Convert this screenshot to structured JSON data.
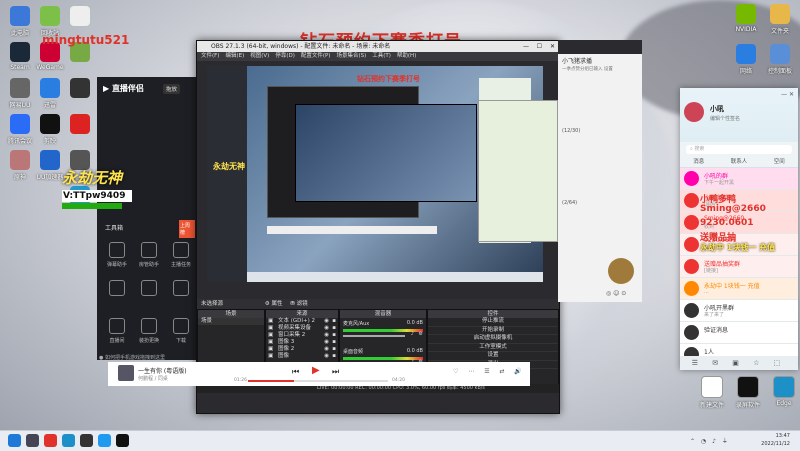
{
  "colors": {
    "obs_dark": "#2b2b2f",
    "accent_red": "#e0322a",
    "overlay_yellow": "#ffe44d",
    "qq_blue": "#1e9bf0"
  },
  "overlay": {
    "top_banner": "钻石预约下赛季打号",
    "username": "mingtutu521",
    "game_title": "永劫无神",
    "vt_handle": "V:TTpw9409",
    "qq_num_line1": "小鸭多鸭",
    "qq_num_line2": "Sming@2660",
    "promo_line1": "9230.0601",
    "promo_line2": "送赠品抽",
    "promo_line3": "永劫中 1块钱一 充值"
  },
  "live_panel": {
    "logo": "直播伴侣",
    "tab_status": "拖放",
    "tools_label": "工具箱",
    "rows": [
      {
        "items": [
          "弹幕助手",
          "房管助手",
          "主播任务"
        ]
      },
      {
        "items": [
          "",
          "",
          ""
        ]
      },
      {
        "items": [
          "直播间",
          "装扮更换",
          "下载"
        ]
      }
    ],
    "hint": "如何把手机游戏拖拽到这里",
    "side_tab": "上周榜"
  },
  "obs": {
    "title": "OBS 27.1.3 (64-bit, windows) - 配置文件: 未命名 - 场景: 未命名",
    "menu": [
      "文件(F)",
      "编辑(E)",
      "视图(V)",
      "停靠(D)",
      "配置文件(P)",
      "场景集合(S)",
      "工具(T)",
      "帮助(H)"
    ],
    "status_label": "未选择源",
    "props_btn": "属性",
    "filter_btn": "滤镜",
    "docks": {
      "scenes": "场景",
      "sources": "来源",
      "mixer": "混音器",
      "controls": "控件"
    },
    "scene_items": [
      "场景"
    ],
    "sources": [
      "文本 (GDI+) 2",
      "视频采集设备",
      "窗口采集 2",
      "图像 3",
      "图像 2",
      "图像"
    ],
    "mixer_tracks": [
      {
        "name": "麦克风/Aux",
        "level": "0.0 dB"
      },
      {
        "name": "桌面音频",
        "level": "0.0 dB"
      }
    ],
    "mixer_tabs": [
      "音频混音器",
      "转场"
    ],
    "controls": [
      "停止推流",
      "开始录制",
      "启动虚拟摄像机",
      "工作室模式",
      "设置",
      "退出"
    ],
    "status_bar": "LIVE: 00:00:00   REC: 00:00:00   CPU: 3.0%, 60.00 fps   码率: 4500 kb/s"
  },
  "music": {
    "song": "一生有你 (粤语版)",
    "artist": "何鹏程 / 同桌",
    "time_cur": "01:26",
    "time_total": "04:20",
    "progress": 0.33
  },
  "qq": {
    "name": "小吼",
    "status": "编辑个性签名",
    "tabs": [
      "消息",
      "联系人",
      "空间"
    ],
    "search": "搜索",
    "chats": [
      {
        "name": "小吼的群",
        "msg": "下午一起开黑",
        "color": "#f0a",
        "bg": "#fde"
      },
      {
        "name": "小鸭多鸭",
        "msg": "[图片]",
        "color": "#e33",
        "bg": "#fdd"
      },
      {
        "name": "Sming@2660",
        "msg": "收到",
        "color": "#e33",
        "bg": "#fdd"
      },
      {
        "name": "9230.0601",
        "msg": "好的",
        "color": "#e33",
        "bg": "#fee"
      },
      {
        "name": "送赠品抽奖群",
        "msg": "[链接]",
        "color": "#e33",
        "bg": "#fee"
      },
      {
        "name": "永劫中 1块钱一 充值",
        "msg": "...",
        "color": "#f80",
        "bg": "#fed"
      },
      {
        "name": "小吼开黑群",
        "msg": "来了来了",
        "color": "#333",
        "bg": "#fff"
      },
      {
        "name": "验证消息",
        "msg": "",
        "color": "#333",
        "bg": "#fff"
      },
      {
        "name": "1人",
        "msg": "",
        "color": "#333",
        "bg": "#fff"
      }
    ]
  },
  "chat_window": {
    "title": "小飞猪求播",
    "notice": "一季点赞分组已输入 设置",
    "count1": "(12/30)",
    "count2": "(2/64)"
  },
  "desktop_icons_left": [
    {
      "label": "此电脑",
      "color": "#3b78d8"
    },
    {
      "label": "回收站",
      "color": "#7cc04a"
    },
    {
      "label": "Steam",
      "color": "#1b2838"
    },
    {
      "label": "WeGame",
      "color": "#c03"
    },
    {
      "label": "网易UU",
      "color": "#666"
    },
    {
      "label": "迅雷",
      "color": "#2a7de1"
    },
    {
      "label": "腾讯会议",
      "color": "#2b6cf6"
    },
    {
      "label": "剪映",
      "color": "#111"
    },
    {
      "label": "原神",
      "color": "#b77"
    },
    {
      "label": "UU加速器",
      "color": "#26c"
    }
  ],
  "desktop_icons_right": [
    {
      "label": "NVIDIA",
      "color": "#76b900"
    },
    {
      "label": "文件夹",
      "color": "#e8b74a"
    },
    {
      "label": "网络",
      "color": "#2a7de1"
    },
    {
      "label": "控制面板",
      "color": "#5a8fd8"
    }
  ],
  "desktop_icons_bottom_right": [
    {
      "label": "新建文件",
      "color": "#fff"
    },
    {
      "label": "录屏软件",
      "color": "#111"
    },
    {
      "label": "Edge",
      "color": "#1e90c8"
    }
  ],
  "taskbar": {
    "apps": [
      {
        "name": "start",
        "color": "#1e78d8"
      },
      {
        "name": "search",
        "color": "#445"
      },
      {
        "name": "netease-music",
        "color": "#e0322a"
      },
      {
        "name": "edge",
        "color": "#1e90c8"
      },
      {
        "name": "obs",
        "color": "#333"
      },
      {
        "name": "qq",
        "color": "#1e9bf0"
      },
      {
        "name": "douyin",
        "color": "#111"
      }
    ],
    "time": "13:47",
    "date": "2022/11/12"
  }
}
